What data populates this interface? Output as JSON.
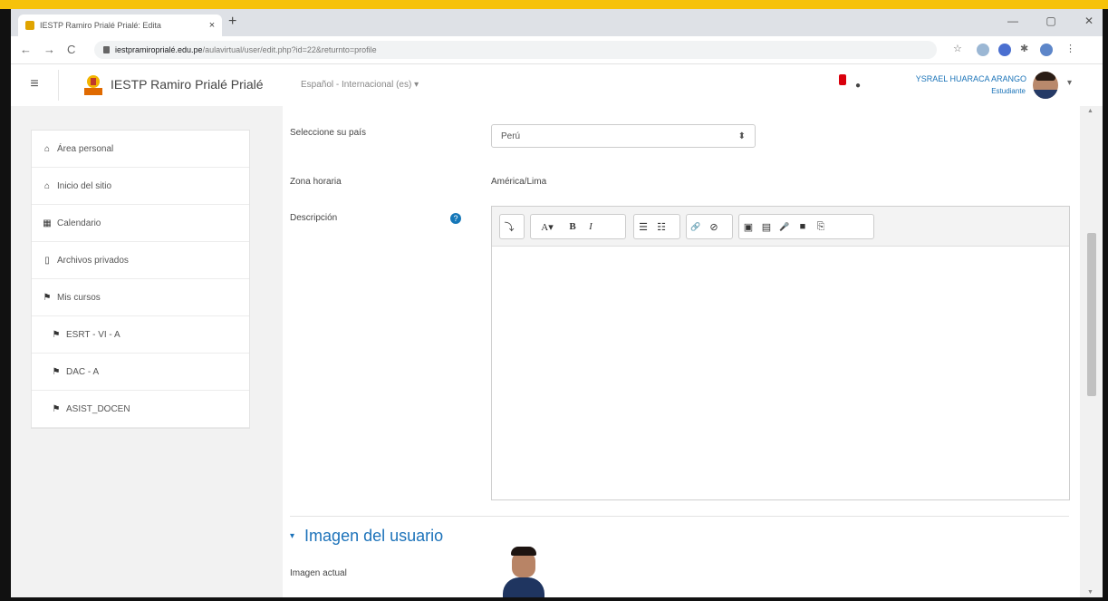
{
  "browser": {
    "tab_title": "IESTP Ramiro Prialé Prialé: Edita",
    "tab_close": "×",
    "new_tab": "+",
    "url_domain": "iestpramiroprialé.edu.pe",
    "url_path": "/aulavirtual/user/edit.php?id=22&returnto=profile",
    "back": "←",
    "forward": "→",
    "reload": "C",
    "minimize": "—",
    "maximize": "▢",
    "close": "✕"
  },
  "navbar": {
    "site_name": "IESTP Ramiro Prialé Prialé",
    "language": "Español - Internacional (es) ▾",
    "user_name": "YSRAEL HUARACA ARANGO",
    "user_role": "Estudiante",
    "menu_caret": "▾",
    "hamburger": "≡"
  },
  "sidebar": {
    "items": [
      {
        "icon": "⌂",
        "label": "Área personal"
      },
      {
        "icon": "⌂",
        "label": "Inicio del sitio"
      },
      {
        "icon": "▦",
        "label": "Calendario"
      },
      {
        "icon": "▯",
        "label": "Archivos privados"
      },
      {
        "icon": "⚑",
        "label": "Mis cursos"
      },
      {
        "icon": "⚑",
        "label": "ESRT - VI - A"
      },
      {
        "icon": "⚑",
        "label": "DAC - A"
      },
      {
        "icon": "⚑",
        "label": "ASIST_DOCEN"
      }
    ]
  },
  "form": {
    "country_label": "Seleccione su país",
    "country_value": "Perú",
    "timezone_label": "Zona horaria",
    "timezone_value": "América/Lima",
    "description_label": "Descripción",
    "help": "?",
    "section_title": "Imagen del usuario",
    "section_chevron": "▾",
    "current_image_label": "Imagen actual",
    "select_caret": "⬍"
  },
  "toolbar": {
    "expand": "⤵",
    "font": "A▾",
    "bold": "B",
    "italic": "I",
    "ul": "☰",
    "ol": "☷",
    "link": "🔗",
    "unlink": "⊘",
    "image": "▣",
    "media": "▤",
    "record_audio": "🎤",
    "record_video": "■",
    "manage_files": "⎘"
  }
}
